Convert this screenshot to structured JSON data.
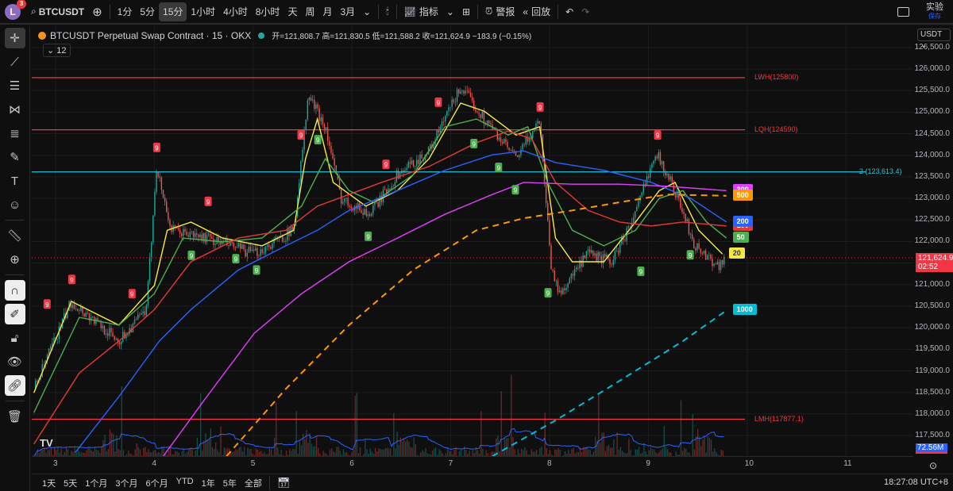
{
  "topbar": {
    "avatar": "L",
    "notifications": "3",
    "symbol": "BTCUSDT",
    "intervals": [
      "1分",
      "5分",
      "15分",
      "1小时",
      "4小时",
      "8小时",
      "天",
      "周",
      "月",
      "3月"
    ],
    "active_interval": "15分",
    "indicators": "指标",
    "alert": "警报",
    "replay": "回放",
    "trading_label": "实验",
    "save_label": "保存"
  },
  "legend": {
    "title": "BTCUSDT Perpetual Swap Contract · 15 · OKX",
    "open_label": "开=",
    "open": "121,808.7",
    "high_label": "高=",
    "high": "121,830.5",
    "low_label": "低=",
    "low": "121,588.2",
    "close_label": "收=",
    "close": "121,624.9",
    "change": "−183.9 (−0.15%)",
    "indicator_count": "12"
  },
  "axis": {
    "currency": "USDT",
    "price_labels": [
      "126,500.0",
      "126,000.0",
      "125,500.0",
      "125,000.0",
      "124,500.0",
      "124,000.0",
      "123,500.0",
      "123,000.0",
      "122,500.0",
      "122,000.0",
      "121,000.0",
      "120,500.0",
      "120,000.0",
      "119,500.0",
      "119,000.0",
      "118,500.0",
      "118,000.0",
      "117,500.0"
    ],
    "current_price": "121,624.9",
    "countdown": "02:52",
    "volume": "72.56M",
    "x_labels": [
      "3",
      "4",
      "5",
      "6",
      "7",
      "8",
      "9",
      "10",
      "11"
    ]
  },
  "bottombar": {
    "ranges": [
      "1天",
      "5天",
      "1个月",
      "3个月",
      "6个月",
      "YTD",
      "1年",
      "5年",
      "全部"
    ],
    "clock": "18:27:08 UTC+8"
  },
  "colors": {
    "up": "#26a69a",
    "down": "#ef5350",
    "ma20": "#f5e94a",
    "ma50": "#4caf50",
    "ma100": "#e53935",
    "ma200": "#2962ff",
    "ma300": "#e040fb",
    "ma500": "#ff9800",
    "ma1000": "#00bcd4",
    "level": "#f23645",
    "cyan_level": "#26c6da"
  },
  "chart_data": {
    "type": "candlestick",
    "xlim": [
      2.78,
      11.6
    ],
    "ylim": [
      117020,
      126700
    ],
    "price_path": [
      [
        2.78,
        118580
      ],
      [
        3.16,
        120610
      ],
      [
        3.64,
        119690
      ],
      [
        3.92,
        120420
      ],
      [
        4.02,
        123740
      ],
      [
        4.17,
        122260
      ],
      [
        4.53,
        122080
      ],
      [
        5.01,
        121710
      ],
      [
        5.41,
        122260
      ],
      [
        5.56,
        125390
      ],
      [
        5.73,
        124660
      ],
      [
        5.89,
        123000
      ],
      [
        6.18,
        122630
      ],
      [
        6.46,
        123550
      ],
      [
        6.78,
        124100
      ],
      [
        7.1,
        125580
      ],
      [
        7.34,
        124840
      ],
      [
        7.66,
        123920
      ],
      [
        7.9,
        124840
      ],
      [
        8.02,
        121340
      ],
      [
        8.1,
        120790
      ],
      [
        8.39,
        121710
      ],
      [
        8.63,
        121530
      ],
      [
        8.87,
        122630
      ],
      [
        9.07,
        124100
      ],
      [
        9.27,
        123180
      ],
      [
        9.47,
        121900
      ],
      [
        9.71,
        121440
      ],
      [
        9.77,
        121625
      ]
    ],
    "levels": [
      {
        "label": "LWH(125800)",
        "price": 125800,
        "color": "level"
      },
      {
        "label": "LQH(124590)",
        "price": 124590,
        "color": "level"
      },
      {
        "label": "2 (123,613.4)",
        "price": 123613.4,
        "color": "cyan_level"
      },
      {
        "label": "LMH(117877.1)",
        "price": 117877.1,
        "color": "level"
      }
    ],
    "moving_averages": [
      {
        "name": "20",
        "color": "ma20",
        "dashed": false,
        "points": [
          [
            2.78,
            118490
          ],
          [
            3.16,
            120610
          ],
          [
            3.64,
            120060
          ],
          [
            4.0,
            120980
          ],
          [
            4.13,
            122260
          ],
          [
            4.37,
            122450
          ],
          [
            4.69,
            122080
          ],
          [
            5.09,
            121900
          ],
          [
            5.41,
            122260
          ],
          [
            5.53,
            123920
          ],
          [
            5.65,
            124840
          ],
          [
            5.81,
            123370
          ],
          [
            6.14,
            122820
          ],
          [
            6.46,
            123180
          ],
          [
            6.78,
            123920
          ],
          [
            7.1,
            125210
          ],
          [
            7.34,
            125020
          ],
          [
            7.66,
            124470
          ],
          [
            7.9,
            124660
          ],
          [
            8.06,
            122080
          ],
          [
            8.23,
            121530
          ],
          [
            8.55,
            121530
          ],
          [
            8.87,
            122450
          ],
          [
            9.11,
            123180
          ],
          [
            9.27,
            123370
          ],
          [
            9.51,
            122260
          ],
          [
            9.75,
            121710
          ]
        ]
      },
      {
        "name": "50",
        "color": "ma50",
        "dashed": false,
        "points": [
          [
            2.78,
            118030
          ],
          [
            3.24,
            120240
          ],
          [
            3.64,
            120060
          ],
          [
            4.0,
            120790
          ],
          [
            4.29,
            122080
          ],
          [
            4.69,
            121990
          ],
          [
            5.09,
            122080
          ],
          [
            5.49,
            122820
          ],
          [
            5.73,
            123920
          ],
          [
            5.97,
            123180
          ],
          [
            6.22,
            122910
          ],
          [
            6.62,
            123550
          ],
          [
            6.94,
            124660
          ],
          [
            7.26,
            124840
          ],
          [
            7.58,
            124470
          ],
          [
            7.78,
            124660
          ],
          [
            7.98,
            123370
          ],
          [
            8.23,
            122260
          ],
          [
            8.55,
            121900
          ],
          [
            8.87,
            122260
          ],
          [
            9.11,
            123000
          ],
          [
            9.35,
            123180
          ],
          [
            9.59,
            122450
          ],
          [
            9.79,
            122080
          ]
        ]
      },
      {
        "name": "100",
        "color": "ma100",
        "dashed": false,
        "points": [
          [
            2.78,
            117300
          ],
          [
            3.24,
            118950
          ],
          [
            3.64,
            119690
          ],
          [
            4.0,
            120420
          ],
          [
            4.37,
            121530
          ],
          [
            4.85,
            122080
          ],
          [
            5.33,
            122260
          ],
          [
            5.65,
            122820
          ],
          [
            5.97,
            123090
          ],
          [
            6.3,
            123370
          ],
          [
            6.78,
            123740
          ],
          [
            7.26,
            124290
          ],
          [
            7.58,
            124560
          ],
          [
            7.82,
            124380
          ],
          [
            8.06,
            123370
          ],
          [
            8.39,
            122720
          ],
          [
            8.71,
            122450
          ],
          [
            9.03,
            122360
          ],
          [
            9.35,
            122450
          ],
          [
            9.79,
            122360
          ]
        ]
      },
      {
        "name": "200",
        "color": "ma200",
        "dashed": false,
        "points": [
          [
            3.2,
            117110
          ],
          [
            3.64,
            118400
          ],
          [
            4.05,
            119690
          ],
          [
            4.37,
            120420
          ],
          [
            4.85,
            121340
          ],
          [
            5.33,
            121900
          ],
          [
            5.65,
            122260
          ],
          [
            5.97,
            122720
          ],
          [
            6.46,
            123180
          ],
          [
            6.94,
            123650
          ],
          [
            7.42,
            124010
          ],
          [
            7.74,
            124100
          ],
          [
            8.06,
            123830
          ],
          [
            8.55,
            123650
          ],
          [
            9.03,
            123370
          ],
          [
            9.43,
            123000
          ],
          [
            9.79,
            122450
          ]
        ]
      },
      {
        "name": "300",
        "color": "ma300",
        "dashed": false,
        "points": [
          [
            4.09,
            117020
          ],
          [
            4.53,
            118400
          ],
          [
            5.01,
            119870
          ],
          [
            5.49,
            120790
          ],
          [
            5.97,
            121530
          ],
          [
            6.46,
            122080
          ],
          [
            6.94,
            122630
          ],
          [
            7.42,
            123090
          ],
          [
            7.74,
            123370
          ],
          [
            8.23,
            123330
          ],
          [
            8.71,
            123330
          ],
          [
            9.19,
            123280
          ],
          [
            9.79,
            123180
          ]
        ]
      },
      {
        "name": "500",
        "color": "ma500",
        "dashed": true,
        "points": [
          [
            4.73,
            117020
          ],
          [
            5.33,
            118580
          ],
          [
            5.97,
            120060
          ],
          [
            6.62,
            121340
          ],
          [
            7.26,
            122260
          ],
          [
            7.74,
            122540
          ],
          [
            8.23,
            122720
          ],
          [
            8.71,
            122910
          ],
          [
            9.19,
            123090
          ],
          [
            9.79,
            123060
          ]
        ]
      },
      {
        "name": "1000",
        "color": "ma1000",
        "dashed": true,
        "points": [
          [
            7.42,
            117020
          ],
          [
            8.06,
            117850
          ],
          [
            8.71,
            118770
          ],
          [
            9.35,
            119690
          ],
          [
            9.79,
            120400
          ]
        ]
      }
    ],
    "td_sequential": {
      "sell_9": [
        [
          2.91,
          120550
        ],
        [
          3.16,
          121120
        ],
        [
          3.77,
          120790
        ],
        [
          4.02,
          124180
        ],
        [
          4.54,
          122930
        ],
        [
          5.48,
          124470
        ],
        [
          6.34,
          123790
        ],
        [
          6.87,
          125230
        ],
        [
          7.9,
          125120
        ],
        [
          9.09,
          124470
        ]
      ],
      "buy_9": [
        [
          4.37,
          121680
        ],
        [
          4.82,
          121600
        ],
        [
          5.03,
          121340
        ],
        [
          5.65,
          124360
        ],
        [
          6.16,
          122120
        ],
        [
          7.23,
          124270
        ],
        [
          7.48,
          123720
        ],
        [
          7.65,
          123200
        ],
        [
          7.98,
          120810
        ],
        [
          8.92,
          121310
        ],
        [
          9.42,
          121690
        ]
      ],
      "label": "9"
    }
  }
}
